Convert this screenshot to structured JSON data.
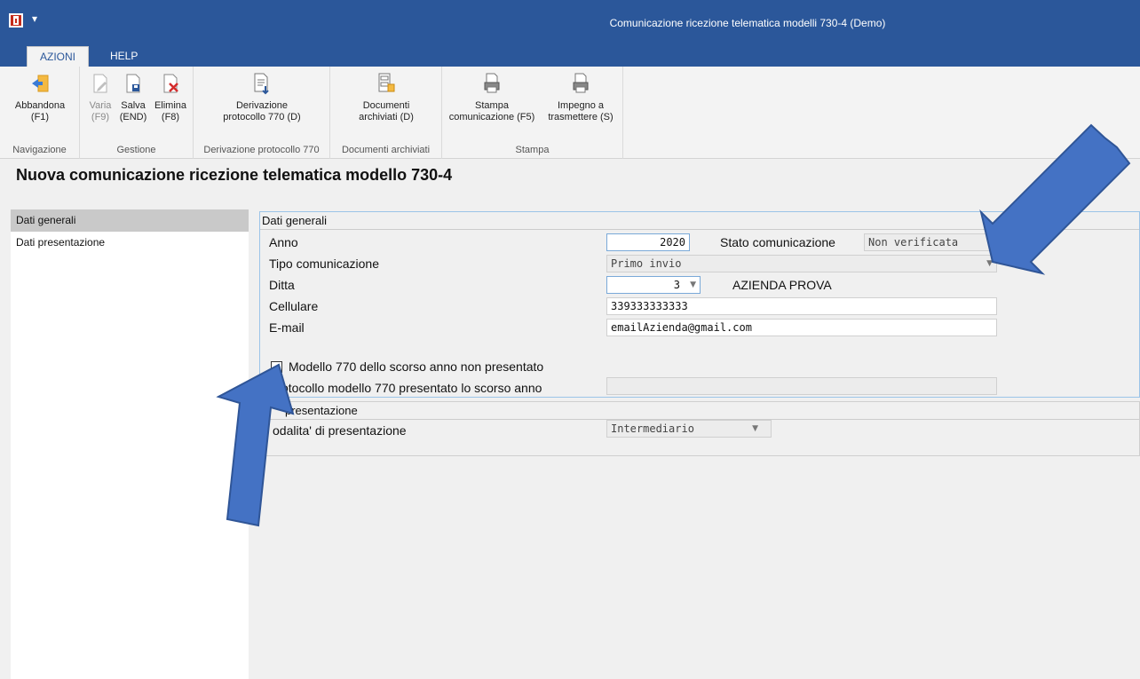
{
  "window": {
    "title": "Comunicazione ricezione telematica modelli 730-4  (Demo)",
    "qa_glyph": "▾"
  },
  "tabs": [
    {
      "label": "AZIONI"
    },
    {
      "label": "HELP"
    }
  ],
  "ribbon": {
    "groups": [
      {
        "label": "Navigazione"
      },
      {
        "label": "Gestione"
      },
      {
        "label": "Derivazione protocollo 770"
      },
      {
        "label": "Documenti archiviati"
      },
      {
        "label": "Stampa"
      }
    ],
    "buttons": {
      "abbandona": {
        "line1": "Abbandona",
        "line2": "(F1)"
      },
      "varia": {
        "line1": "Varia",
        "line2": "(F9)"
      },
      "salva": {
        "line1": "Salva",
        "line2": "(END)"
      },
      "elimina": {
        "line1": "Elimina",
        "line2": "(F8)"
      },
      "derivazione": {
        "line1": "Derivazione",
        "line2": "protocollo 770 (D)"
      },
      "documenti": {
        "line1": "Documenti",
        "line2": "archiviati (D)"
      },
      "stampa": {
        "line1": "Stampa",
        "line2": "comunicazione (F5)"
      },
      "impegno": {
        "line1": "Impegno a",
        "line2": "trasmettere (S)"
      }
    }
  },
  "page": {
    "title": "Nuova comunicazione ricezione telematica modello 730-4"
  },
  "nav": {
    "items": [
      {
        "label": "Dati generali",
        "active": true
      },
      {
        "label": "Dati presentazione",
        "active": false
      }
    ]
  },
  "dati_generali": {
    "header": "Dati generali",
    "anno": {
      "label": "Anno",
      "value": "2020"
    },
    "stato": {
      "label": "Stato comunicazione",
      "value": "Non verificata"
    },
    "tipo": {
      "label": "Tipo comunicazione",
      "value": "Primo invio"
    },
    "ditta": {
      "label": "Ditta",
      "value": "3",
      "name": "AZIENDA PROVA"
    },
    "cellulare": {
      "label": "Cellulare",
      "value": "339333333333"
    },
    "email": {
      "label": "E-mail",
      "value": "emailAzienda@gmail.com"
    },
    "modello770": {
      "label": "Modello 770 dello scorso anno non presentato",
      "checked": true,
      "check_glyph": "✓"
    },
    "protocollo": {
      "label": "Protocollo modello 770 presentato lo scorso anno",
      "value": ""
    }
  },
  "dati_presentazione": {
    "header": "presentazione",
    "modalita": {
      "label": "odalita' di presentazione",
      "value": "Intermediario"
    }
  },
  "dropdown_glyph": "▼",
  "colors": {
    "accent": "#2b579a",
    "annotation_arrow": "#4472c4",
    "field_border_focus": "#7aa9d8"
  }
}
